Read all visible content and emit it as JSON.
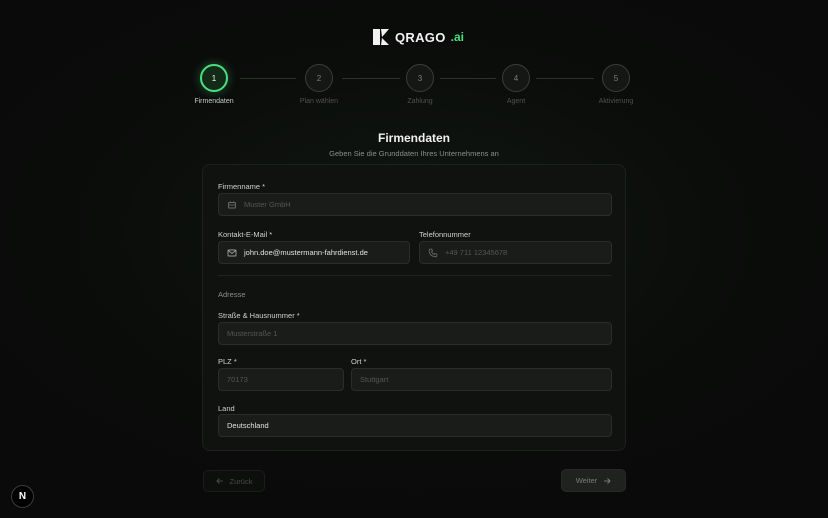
{
  "brand": {
    "name": "QRAGO",
    "suffix": ".ai"
  },
  "steps": [
    {
      "number": "1",
      "label": "Firmendaten",
      "active": true
    },
    {
      "number": "2",
      "label": "Plan wählen",
      "active": false
    },
    {
      "number": "3",
      "label": "Zahlung",
      "active": false
    },
    {
      "number": "4",
      "label": "Agent",
      "active": false
    },
    {
      "number": "5",
      "label": "Aktivierung",
      "active": false
    }
  ],
  "header": {
    "title": "Firmendaten",
    "subtitle": "Geben Sie die Grunddaten Ihres Unternehmens an"
  },
  "form": {
    "company_name": {
      "label": "Firmenname *",
      "placeholder": "Muster GmbH",
      "value": ""
    },
    "email": {
      "label": "Kontakt-E-Mail *",
      "placeholder": "",
      "value": "john.doe@mustermann-fahrdienst.de"
    },
    "phone": {
      "label": "Telefonnummer",
      "placeholder": "+49 711 12345678",
      "value": ""
    },
    "address_section": "Adresse",
    "street": {
      "label": "Straße & Hausnummer *",
      "placeholder": "Musterstraße 1",
      "value": ""
    },
    "zip": {
      "label": "PLZ *",
      "placeholder": "70173",
      "value": ""
    },
    "city": {
      "label": "Ort *",
      "placeholder": "Stuttgart",
      "value": ""
    },
    "country": {
      "label": "Land",
      "placeholder": "",
      "value": "Deutschland"
    }
  },
  "nav": {
    "back_label": "Zurück",
    "next_label": "Weiter"
  },
  "dev_badge": "N",
  "colors": {
    "accent": "#4ade80",
    "background": "#0a0b0a",
    "card": "#101210",
    "field": "#1a1c1a"
  },
  "icons": {
    "company": "building-icon",
    "email": "mail-icon",
    "phone": "phone-icon",
    "back": "arrow-left-icon",
    "next": "arrow-right-icon"
  }
}
